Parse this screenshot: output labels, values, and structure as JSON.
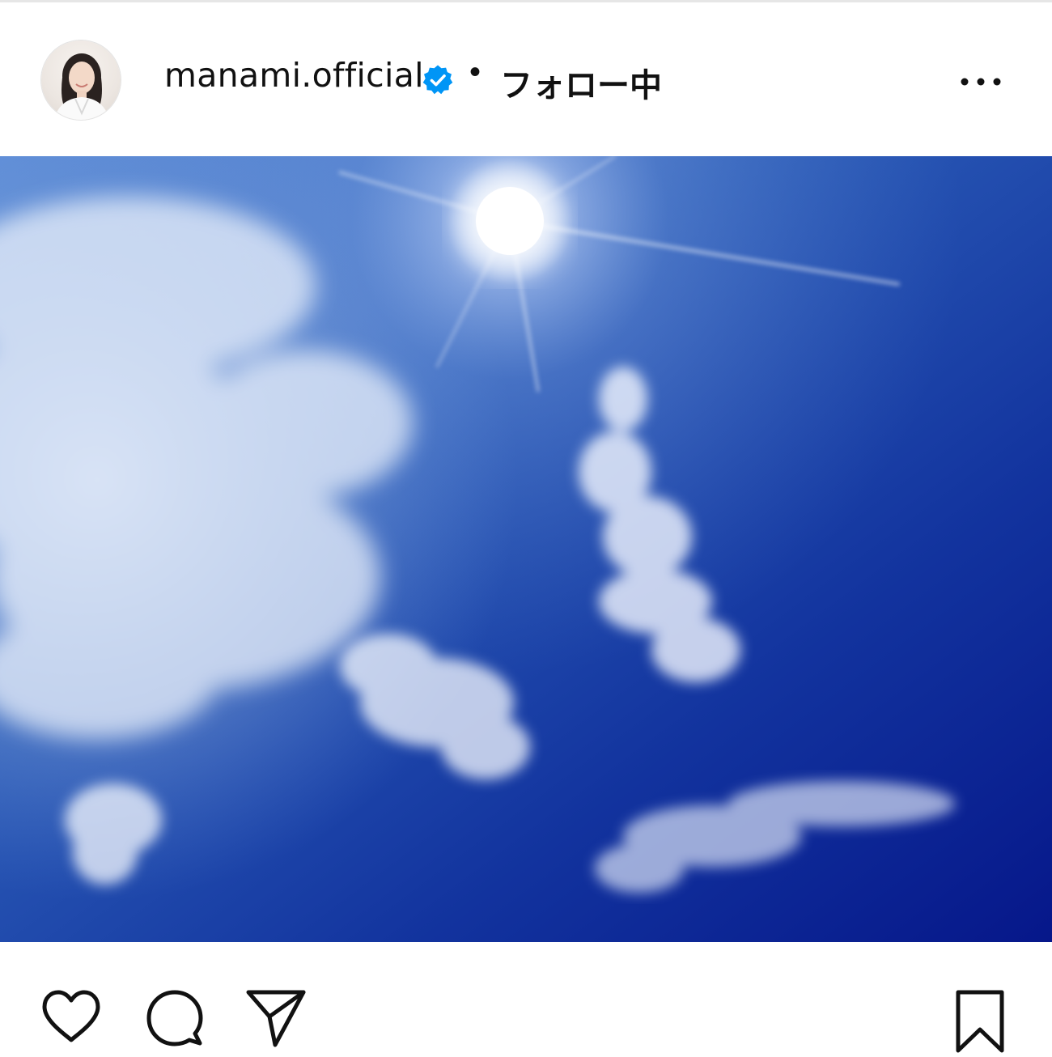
{
  "post": {
    "username": "manami.official",
    "separator": "•",
    "follow_status": "フォロー中",
    "verified": true
  },
  "icons": {
    "avatar": "profile-photo",
    "verified": "verified-badge-icon",
    "more": "more-options-icon",
    "like": "heart-icon",
    "comment": "comment-icon",
    "share": "share-icon",
    "save": "bookmark-icon"
  },
  "colors": {
    "verified_blue": "#0095f6",
    "sky_top": "#3e6fc4",
    "sky_bottom": "#071c8c",
    "icon": "#111111"
  }
}
